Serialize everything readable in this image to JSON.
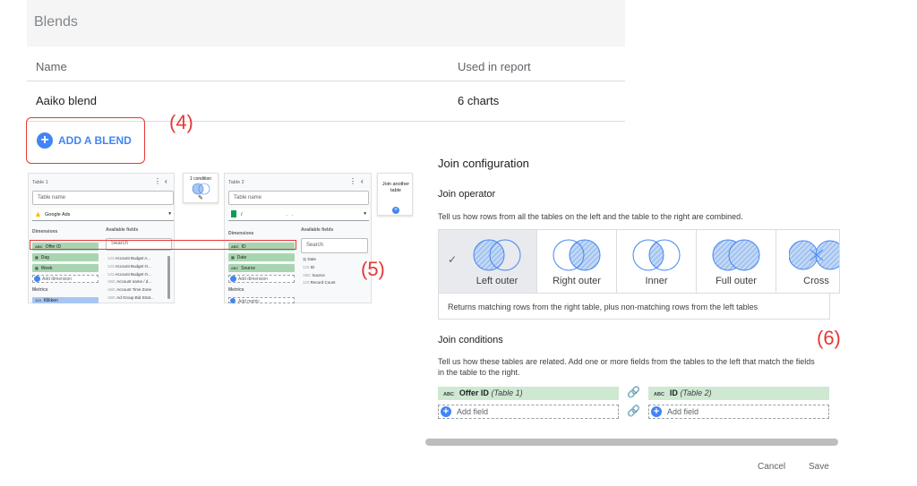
{
  "blends": {
    "title": "Blends",
    "col_name": "Name",
    "col_used": "Used in report",
    "row_name": "Aaiko blend",
    "row_used": "6 charts",
    "add_label": "ADD A BLEND"
  },
  "annotations": {
    "a4": "(4)",
    "a5": "(5)",
    "a6": "(6)"
  },
  "mini_editor": {
    "table1": {
      "title": "Table 1",
      "name_placeholder": "Table name",
      "source": "Google Ads",
      "dimensions_label": "Dimensions",
      "dimension_chips": [
        "Offer ID",
        "Dag",
        "Week"
      ],
      "add_dimension": "Add dimension",
      "metrics_label": "Metrics",
      "metric_chip": "Klikken",
      "available_label": "Available fields",
      "search": "Search",
      "fields": [
        "Account Budget A...",
        "Account Budget O...",
        "Account Budget O...",
        "Account name / d...",
        "Account Time Zone",
        "Ad Group Bid Strat..."
      ]
    },
    "condition": {
      "label": "1 condition"
    },
    "table2": {
      "title": "Table 2",
      "name_placeholder": "Table name",
      "source": "/                                .   .",
      "dimensions_label": "Dimensions",
      "dimension_chips": [
        "ID",
        "Date",
        "Source"
      ],
      "add_dimension": "Add dimension",
      "metrics_label": "Metrics",
      "add_metric": "Add metric",
      "available_label": "Available fields",
      "search": "Search",
      "fields": [
        "Date",
        "ID",
        "Source",
        "Record Count"
      ]
    },
    "join_another": {
      "label": "Join another table"
    }
  },
  "join": {
    "title": "Join configuration",
    "operator_heading": "Join operator",
    "operator_desc": "Tell us how rows from all the tables on the left and the table to the right are combined.",
    "operators": [
      "Left outer",
      "Right outer",
      "Inner",
      "Full outer",
      "Cross"
    ],
    "selected_desc": "Returns matching rows from the right table, plus non-matching rows from the left tables",
    "conditions_heading": "Join conditions",
    "conditions_desc": "Tell us how these tables are related. Add one or more fields from the tables to the left that match the fields in the table to the right.",
    "left_field": "Offer ID",
    "left_table": "(Table 1)",
    "right_field": "ID",
    "right_table": "(Table 2)",
    "add_field": "Add field",
    "cancel": "Cancel",
    "save": "Save"
  },
  "colors": {
    "accent": "#4285f4",
    "annotation": "#e53935",
    "chip_green": "#cfe8d2"
  }
}
